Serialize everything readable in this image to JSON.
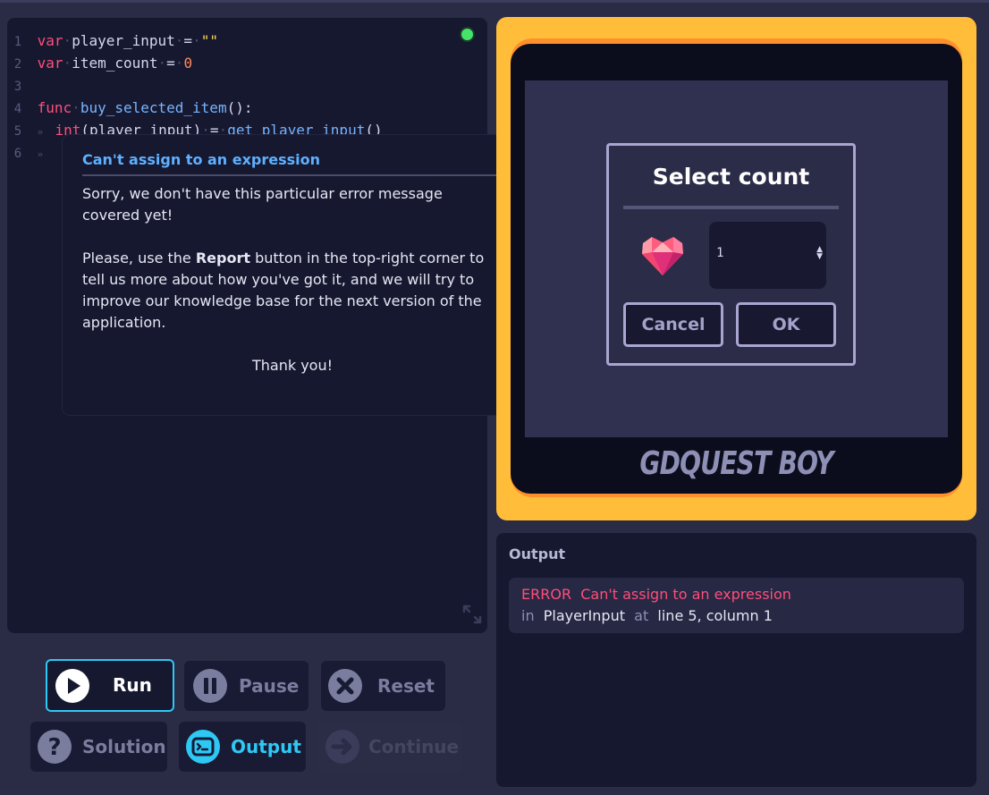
{
  "editor": {
    "lines": [
      {
        "num": "1",
        "tokens": [
          {
            "t": "var",
            "c": "kw"
          },
          {
            "t": "·",
            "c": "dot"
          },
          {
            "t": "player_input",
            "c": "id"
          },
          {
            "t": "·",
            "c": "dot"
          },
          {
            "t": "=",
            "c": "id"
          },
          {
            "t": "·",
            "c": "dot"
          },
          {
            "t": "\"\"",
            "c": "str"
          }
        ]
      },
      {
        "num": "2",
        "tokens": [
          {
            "t": "var",
            "c": "kw"
          },
          {
            "t": "·",
            "c": "dot"
          },
          {
            "t": "item_count",
            "c": "id"
          },
          {
            "t": "·",
            "c": "dot"
          },
          {
            "t": "=",
            "c": "id"
          },
          {
            "t": "·",
            "c": "dot"
          },
          {
            "t": "0",
            "c": "num"
          }
        ]
      },
      {
        "num": "3",
        "tokens": []
      },
      {
        "num": "4",
        "tokens": [
          {
            "t": "func",
            "c": "kw"
          },
          {
            "t": "·",
            "c": "dot"
          },
          {
            "t": "buy_selected_item",
            "c": "fn"
          },
          {
            "t": "():",
            "c": "id"
          }
        ]
      },
      {
        "num": "5",
        "tokens": [
          {
            "t": "»  ",
            "c": "tab"
          },
          {
            "t": "int",
            "c": "kw"
          },
          {
            "t": "(player_input)",
            "c": "id"
          },
          {
            "t": "·",
            "c": "dot"
          },
          {
            "t": "=",
            "c": "id"
          },
          {
            "t": "·",
            "c": "dot"
          },
          {
            "t": "get_player_input",
            "c": "fn"
          },
          {
            "t": "()",
            "c": "id"
          }
        ]
      },
      {
        "num": "6",
        "tokens": [
          {
            "t": "»",
            "c": "tab"
          }
        ]
      }
    ]
  },
  "tooltip": {
    "title": "Can't assign to an expression",
    "p1": "Sorry, we don't have this particular error message covered yet!",
    "p2_pre": "Please, use the ",
    "p2_bold": "Report",
    "p2_post": " button in the top-right corner to tell us more about how you've got it, and we will try to improve our knowledge base for the next version of the application.",
    "thanks": "Thank you!"
  },
  "game": {
    "brand": "GDQUEST BOY",
    "dialog": {
      "title": "Select count",
      "count_value": "1",
      "cancel_label": "Cancel",
      "ok_label": "OK",
      "item_icon": "heart-gem-icon"
    }
  },
  "output": {
    "title": "Output",
    "error_label": "ERROR",
    "error_message": "Can't assign to an expression",
    "in_label": "in",
    "source": "PlayerInput",
    "at_label": "at",
    "location": "line 5, column 1"
  },
  "buttons": {
    "run": "Run",
    "pause": "Pause",
    "reset": "Reset",
    "solution": "Solution",
    "output": "Output",
    "continue": "Continue"
  },
  "colors": {
    "accent": "#2ec8f5",
    "error": "#ff4e7a",
    "frame": "#ffbd39",
    "status_ok": "#45e36b"
  }
}
